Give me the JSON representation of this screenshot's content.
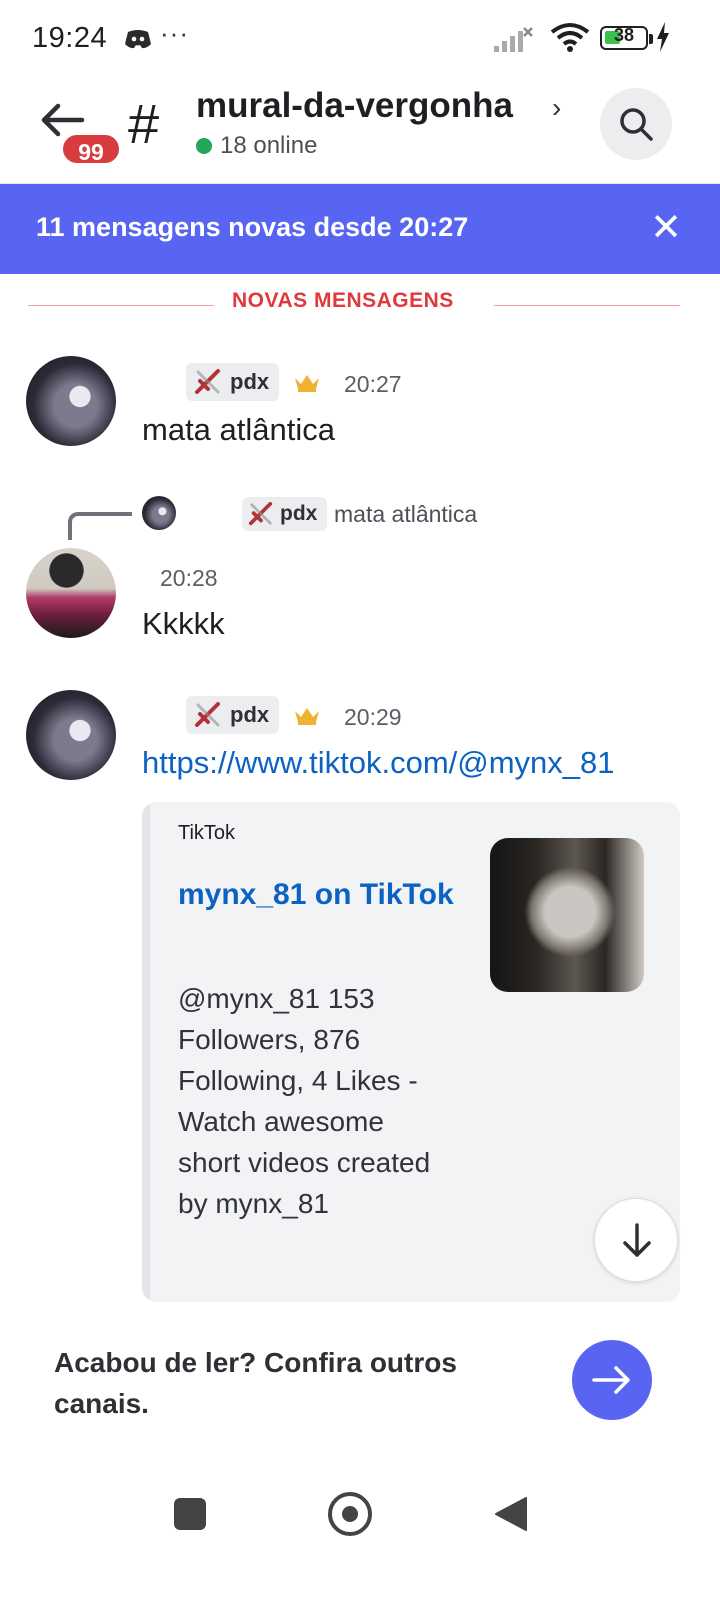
{
  "status_bar": {
    "time": "19:24",
    "dots": "···",
    "battery": "38",
    "icons": [
      "discord-icon",
      "signal-icon",
      "wifi-icon",
      "battery-icon",
      "charging-icon"
    ]
  },
  "header": {
    "badge_count": "99",
    "hash_symbol": "#",
    "channel_name": "mural-da-vergonha",
    "chevron": "›",
    "online_text": "18 online"
  },
  "banner": {
    "text": "11 mensagens novas desde 20:27",
    "close": "✕"
  },
  "divider": {
    "label": "NOVAS MENSAGENS",
    "color": "#f23f43"
  },
  "messages": [
    {
      "author": "pdx",
      "time": "20:27",
      "text": "mata atlântica"
    },
    {
      "reply_to_author": "pdx",
      "reply_to_text": "mata atlântica",
      "time": "20:28",
      "text": "Kkkkk"
    },
    {
      "author": "pdx",
      "time": "20:29",
      "link": "https://www.tiktok.com/@mynx_81"
    }
  ],
  "embed": {
    "provider": "TikTok",
    "title": "mynx_81 on TikTok",
    "description": "@mynx_81 153 Followers, 876 Following, 4 Likes - Watch awesome short videos created by mynx_81"
  },
  "footer": {
    "text": "Acabou de ler? Confira outros canais."
  },
  "colors": {
    "accent": "#5865f2",
    "link": "#0b62c2",
    "online": "#23a55a",
    "badge": "#d83c3e",
    "crown": "#f0b232"
  }
}
